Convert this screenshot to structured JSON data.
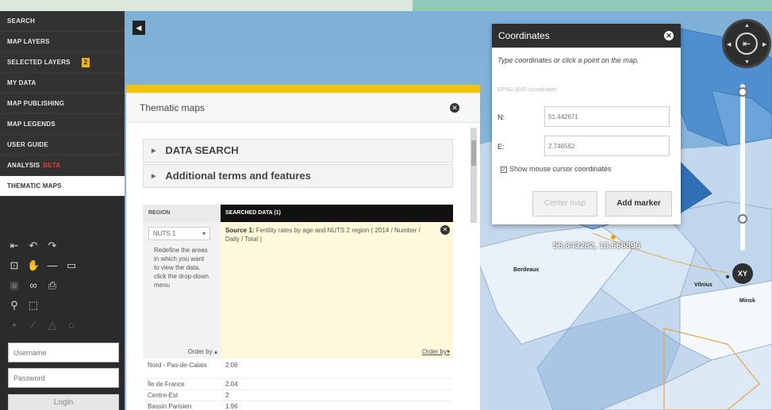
{
  "sidebar": {
    "items": [
      {
        "label": "SEARCH"
      },
      {
        "label": "MAP LAYERS"
      },
      {
        "label": "SELECTED LAYERS",
        "badge": "2"
      },
      {
        "label": "MY DATA"
      },
      {
        "label": "MAP PUBLISHING"
      },
      {
        "label": "MAP LEGENDS"
      },
      {
        "label": "USER GUIDE"
      },
      {
        "label": "ANALYSIS",
        "tag": "BETA"
      },
      {
        "label": "THEMATIC MAPS"
      }
    ],
    "login": {
      "username_placeholder": "Username",
      "password_placeholder": "Password",
      "button_label": "Login"
    }
  },
  "map": {
    "labels": {
      "coords_readout": "56.843282, 18.666896",
      "city1": "Bordeaux",
      "city2": "Vilnius",
      "city3": "Minsk"
    },
    "nav_label": "XY"
  },
  "thematic": {
    "title": "Thematic maps",
    "accordion": [
      "DATA SEARCH",
      "Additional terms and features"
    ],
    "region_header": "REGION",
    "searched_header": "SEARCHED DATA (1)",
    "nuts_value": "NUTS 1",
    "hint": "Redefine the areas in which you want to view the data, click the drop-down menu",
    "source_label": "Source 1:",
    "source_text": "Fertility rates by age and NUTS 2 region ( 2014 / Number / Daily / Total )",
    "order_left": "Order by",
    "order_right": "Order by",
    "rows": [
      {
        "region": "Nord - Pas-de-Calais",
        "value": "2.06"
      },
      {
        "region": "Île de France",
        "value": "2.04"
      },
      {
        "region": "Centre-Est",
        "value": "2"
      },
      {
        "region": "Bassin Parisien",
        "value": "1.96"
      }
    ]
  },
  "coordinates": {
    "title": "Coordinates",
    "instructions": "Type coordinates or click a point on the map.",
    "crs": "EPSG:3035 coordinates",
    "n_label": "N:",
    "n_value": "51.442671",
    "e_label": "E:",
    "e_value": "2.746562",
    "checkbox_label": "Show mouse cursor coordinates",
    "center_label": "Center map",
    "add_label": "Add marker"
  }
}
